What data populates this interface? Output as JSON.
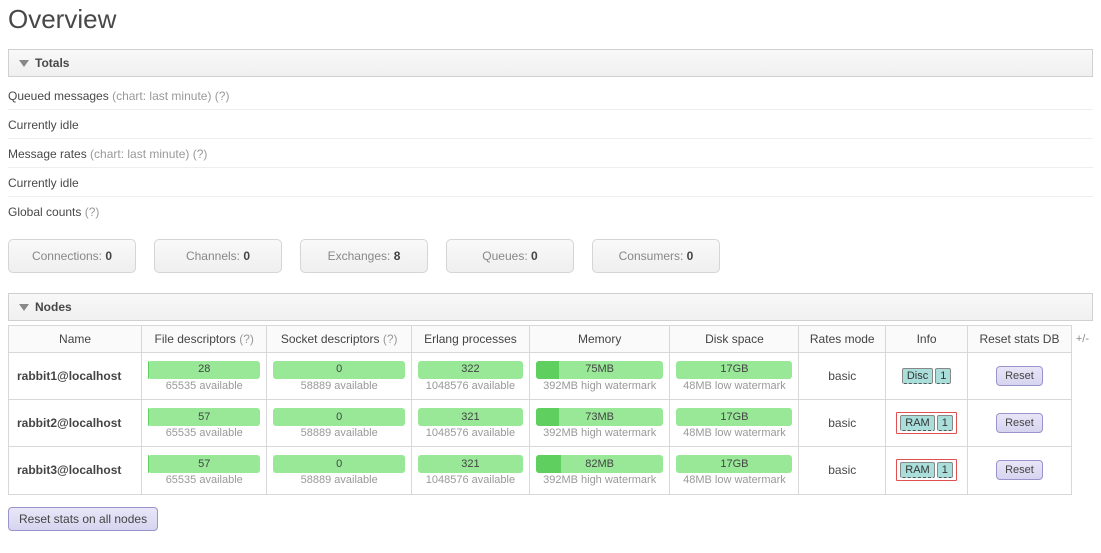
{
  "page": {
    "title": "Overview"
  },
  "sections": {
    "totals": {
      "header": "Totals"
    },
    "nodes": {
      "header": "Nodes"
    }
  },
  "queued": {
    "label": "Queued messages",
    "chart_note": "(chart: last minute)",
    "help": "(?)",
    "idle": "Currently idle"
  },
  "rates": {
    "label": "Message rates",
    "chart_note": "(chart: last minute)",
    "help": "(?)",
    "idle": "Currently idle"
  },
  "global_counts": {
    "label": "Global counts",
    "help": "(?)",
    "items": [
      {
        "label": "Connections:",
        "value": "0"
      },
      {
        "label": "Channels:",
        "value": "0"
      },
      {
        "label": "Exchanges:",
        "value": "8"
      },
      {
        "label": "Queues:",
        "value": "0"
      },
      {
        "label": "Consumers:",
        "value": "0"
      }
    ]
  },
  "table": {
    "headers": {
      "name": "Name",
      "fd": "File descriptors",
      "sd": "Socket descriptors",
      "ep": "Erlang processes",
      "mem": "Memory",
      "disk": "Disk space",
      "rm": "Rates mode",
      "info": "Info",
      "reset": "Reset stats DB",
      "help": "(?)",
      "plusminus": "+/-"
    },
    "rows": [
      {
        "name": "rabbit1@localhost",
        "fd": {
          "value": "28",
          "sub": "65535 available",
          "fill": 1
        },
        "sd": {
          "value": "0",
          "sub": "58889 available",
          "fill": 0
        },
        "ep": {
          "value": "322",
          "sub": "1048576 available",
          "fill": 0
        },
        "mem": {
          "value": "75MB",
          "sub": "392MB high watermark",
          "fill": 18
        },
        "disk": {
          "value": "17GB",
          "sub": "48MB low watermark",
          "fill": 0
        },
        "rm": "basic",
        "info": {
          "type": "Disc",
          "stats": "1",
          "hl": false
        },
        "reset": "Reset"
      },
      {
        "name": "rabbit2@localhost",
        "fd": {
          "value": "57",
          "sub": "65535 available",
          "fill": 1
        },
        "sd": {
          "value": "0",
          "sub": "58889 available",
          "fill": 0
        },
        "ep": {
          "value": "321",
          "sub": "1048576 available",
          "fill": 0
        },
        "mem": {
          "value": "73MB",
          "sub": "392MB high watermark",
          "fill": 18
        },
        "disk": {
          "value": "17GB",
          "sub": "48MB low watermark",
          "fill": 0
        },
        "rm": "basic",
        "info": {
          "type": "RAM",
          "stats": "1",
          "hl": true
        },
        "reset": "Reset"
      },
      {
        "name": "rabbit3@localhost",
        "fd": {
          "value": "57",
          "sub": "65535 available",
          "fill": 1
        },
        "sd": {
          "value": "0",
          "sub": "58889 available",
          "fill": 0
        },
        "ep": {
          "value": "321",
          "sub": "1048576 available",
          "fill": 0
        },
        "mem": {
          "value": "82MB",
          "sub": "392MB high watermark",
          "fill": 20
        },
        "disk": {
          "value": "17GB",
          "sub": "48MB low watermark",
          "fill": 0
        },
        "rm": "basic",
        "info": {
          "type": "RAM",
          "stats": "1",
          "hl": true
        },
        "reset": "Reset"
      }
    ]
  },
  "buttons": {
    "reset_all": "Reset stats on all nodes"
  }
}
